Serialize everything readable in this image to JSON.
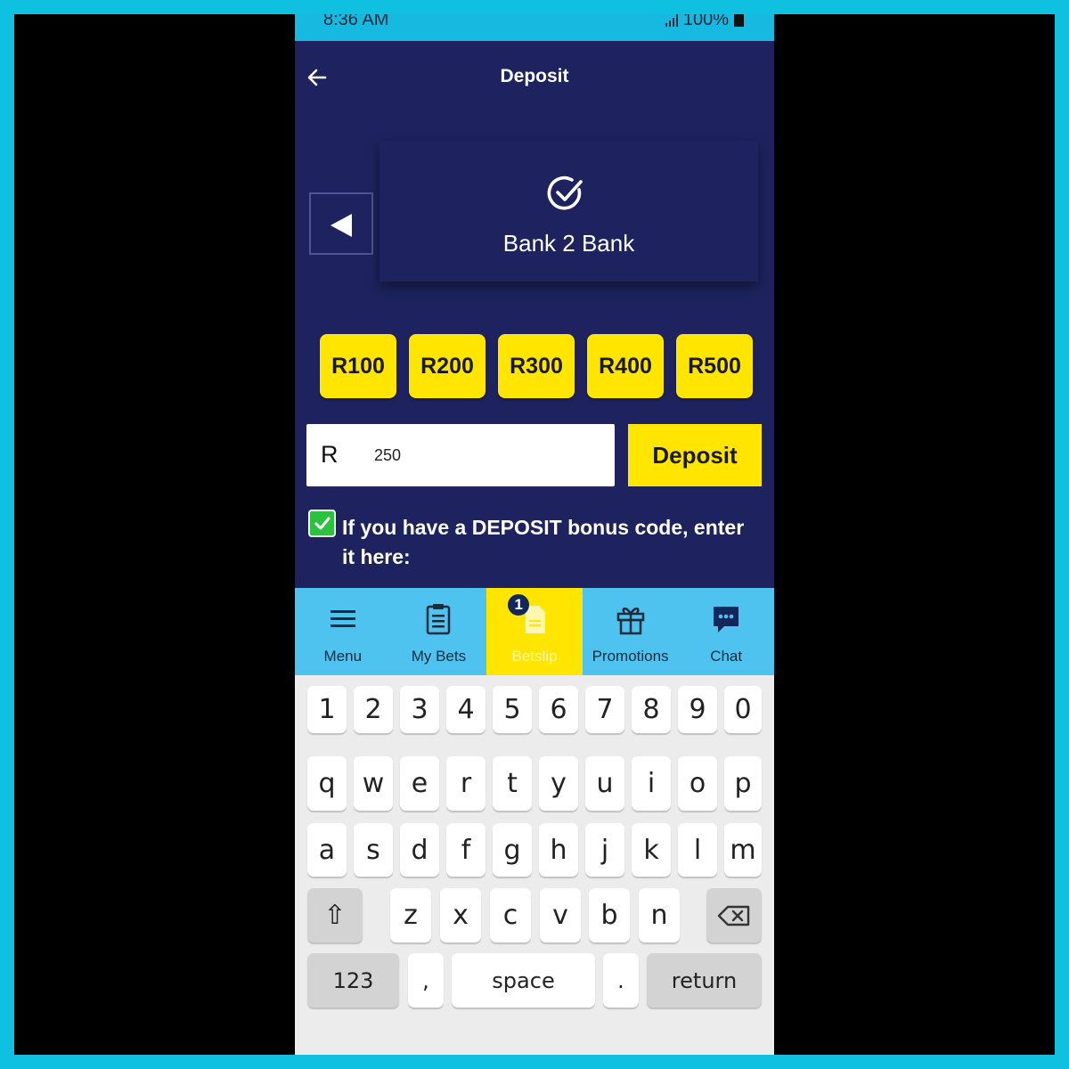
{
  "status_bar": {
    "time": "8:36 AM",
    "battery": "100%"
  },
  "header": {
    "title": "Deposit"
  },
  "payment_method": {
    "label": "Bank 2 Bank"
  },
  "quick_amounts": [
    "R100",
    "R200",
    "R300",
    "R400",
    "R500"
  ],
  "amount_input": {
    "currency": "R",
    "value": "250"
  },
  "deposit_button": {
    "label": "Deposit"
  },
  "bonus_code": {
    "checked": true,
    "label": "If you have a DEPOSIT bonus code, enter it here:"
  },
  "bottom_nav": {
    "items": [
      {
        "label": "Menu",
        "icon": "menu-icon"
      },
      {
        "label": "My Bets",
        "icon": "clipboard-icon"
      },
      {
        "label": "Betslip",
        "icon": "betslip-icon",
        "badge": "1",
        "active": true
      },
      {
        "label": "Promotions",
        "icon": "gift-icon"
      },
      {
        "label": "Chat",
        "icon": "chat-icon"
      }
    ]
  },
  "keyboard": {
    "row_numbers": [
      "1",
      "2",
      "3",
      "4",
      "5",
      "6",
      "7",
      "8",
      "9",
      "0"
    ],
    "row_1": [
      "q",
      "w",
      "e",
      "r",
      "t",
      "y",
      "u",
      "i",
      "o",
      "p"
    ],
    "row_2": [
      "a",
      "s",
      "d",
      "f",
      "g",
      "h",
      "j",
      "k",
      "l",
      "m"
    ],
    "row_3": [
      "z",
      "x",
      "c",
      "v",
      "b",
      "n"
    ],
    "shift": "⇧",
    "mode_key": "123",
    "comma": ",",
    "space": "space",
    "period": ".",
    "return": "return"
  },
  "colors": {
    "app_background": "#1e235f",
    "accent_yellow": "#ffe500",
    "nav_blue": "#4fc3f0",
    "status_bar": "#17b9e0",
    "frame": "#0fc0e0",
    "checkbox_green": "#2cc13f"
  }
}
